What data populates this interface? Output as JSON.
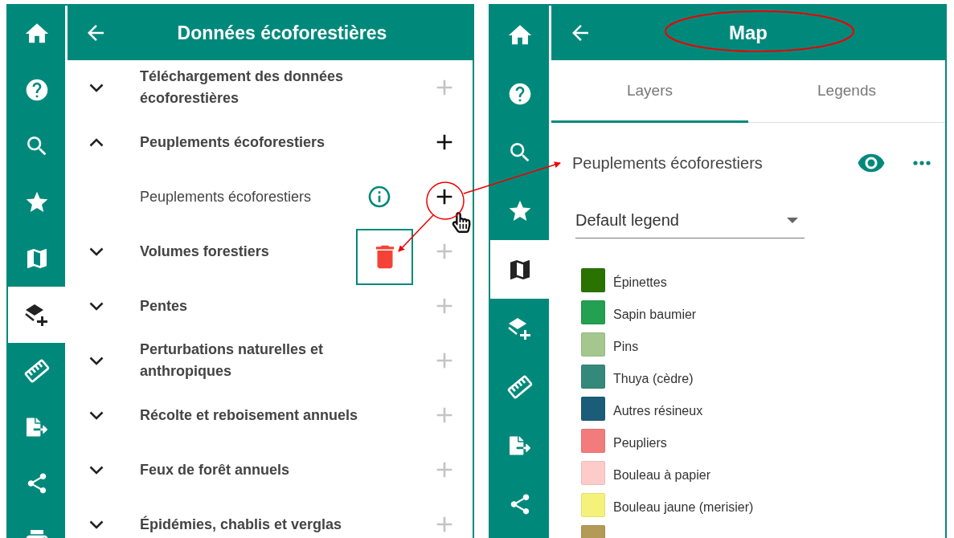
{
  "left_panel": {
    "title": "Données écoforestières",
    "nav": [
      {
        "selected": false
      },
      {
        "selected": false
      },
      {
        "selected": false
      },
      {
        "selected": false
      },
      {
        "selected": false
      },
      {
        "selected": true
      },
      {
        "selected": false
      },
      {
        "selected": false
      },
      {
        "selected": false
      },
      {
        "selected": false
      }
    ],
    "rows": [
      {
        "label": "Téléchargement des données écoforestières",
        "expanded": false,
        "disabled": true,
        "children": []
      },
      {
        "label": "Peuplements écoforestiers",
        "expanded": true,
        "disabled": false,
        "children": [
          {
            "label": "Peuplements écoforestiers",
            "disabled": false
          }
        ]
      },
      {
        "label": "Volumes forestiers",
        "expanded": false,
        "disabled": true,
        "children": []
      },
      {
        "label": "Pentes",
        "expanded": false,
        "disabled": true,
        "children": []
      },
      {
        "label": "Perturbations naturelles et anthropiques",
        "expanded": false,
        "disabled": true,
        "children": []
      },
      {
        "label": "Récolte et reboisement annuels",
        "expanded": false,
        "disabled": true,
        "children": []
      },
      {
        "label": "Feux de forêt annuels",
        "expanded": false,
        "disabled": true,
        "children": []
      },
      {
        "label": "Épidémies, chablis et verglas",
        "expanded": false,
        "disabled": true,
        "children": []
      }
    ]
  },
  "right_panel": {
    "title": "Map",
    "nav": [
      {
        "selected": false
      },
      {
        "selected": false
      },
      {
        "selected": false
      },
      {
        "selected": false
      },
      {
        "selected": true
      },
      {
        "selected": false
      },
      {
        "selected": false
      },
      {
        "selected": false
      },
      {
        "selected": false
      }
    ],
    "tabs": [
      {
        "label": "Layers",
        "selected": true
      },
      {
        "label": "Legends",
        "selected": false
      }
    ],
    "layer": {
      "name": "Peuplements écoforestiers",
      "visible": true
    },
    "legend_select": {
      "value": "Default legend"
    },
    "legend": [
      {
        "label": "Épinettes",
        "color": "#2a7300"
      },
      {
        "label": "Sapin baumier",
        "color": "#23a052"
      },
      {
        "label": "Pins",
        "color": "#a3c78e"
      },
      {
        "label": "Thuya (cèdre)",
        "color": "#35897a"
      },
      {
        "label": "Autres résineux",
        "color": "#1b5d78"
      },
      {
        "label": "Peupliers",
        "color": "#f27b7b"
      },
      {
        "label": "Bouleau à papier",
        "color": "#fecbcb"
      },
      {
        "label": "Bouleau jaune (merisier)",
        "color": "#f4f27a"
      },
      {
        "color": "#b39b57"
      }
    ]
  }
}
